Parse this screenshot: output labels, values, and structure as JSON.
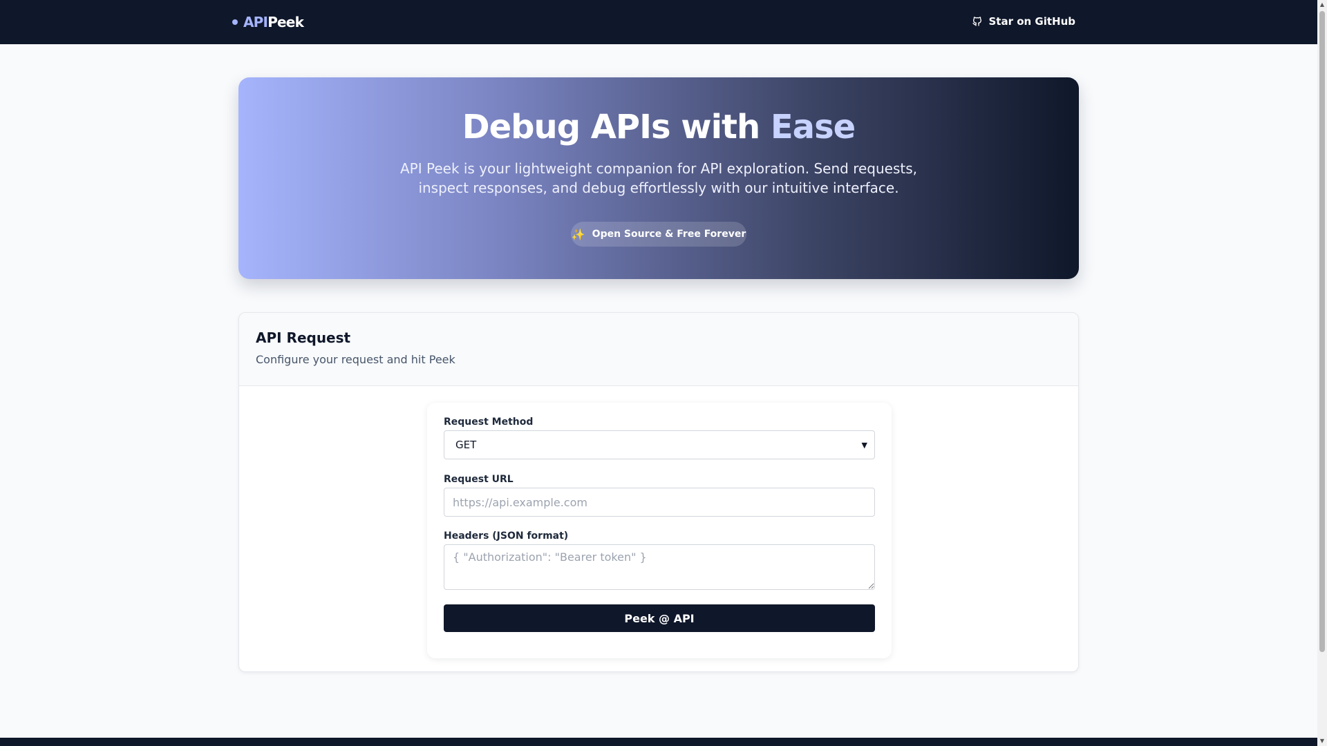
{
  "nav": {
    "brand_part1": "API",
    "brand_part2": "Peek",
    "github_label": "Star on GitHub"
  },
  "hero": {
    "title_main": "Debug APIs with",
    "title_accent": "Ease",
    "subtitle": "API Peek is your lightweight companion for API exploration. Send requests, inspect responses, and debug effortlessly with our intuitive interface.",
    "badge_icon": "sparkles-icon",
    "badge_label": "Open Source & Free Forever"
  },
  "request_card": {
    "title": "API Request",
    "subtitle": "Configure your request and hit Peek",
    "method_label": "Request Method",
    "method_value": "GET",
    "url_label": "Request URL",
    "url_placeholder": "https://api.example.com",
    "headers_label": "Headers (JSON format)",
    "headers_placeholder": "{ \"Authorization\": \"Bearer token\" }",
    "submit_label": "Peek @ API"
  },
  "colors": {
    "nav_bg": "#0f172a",
    "accent": "#a5b4fc",
    "button_bg": "#0f172a",
    "page_bg": "#f8fafc"
  }
}
